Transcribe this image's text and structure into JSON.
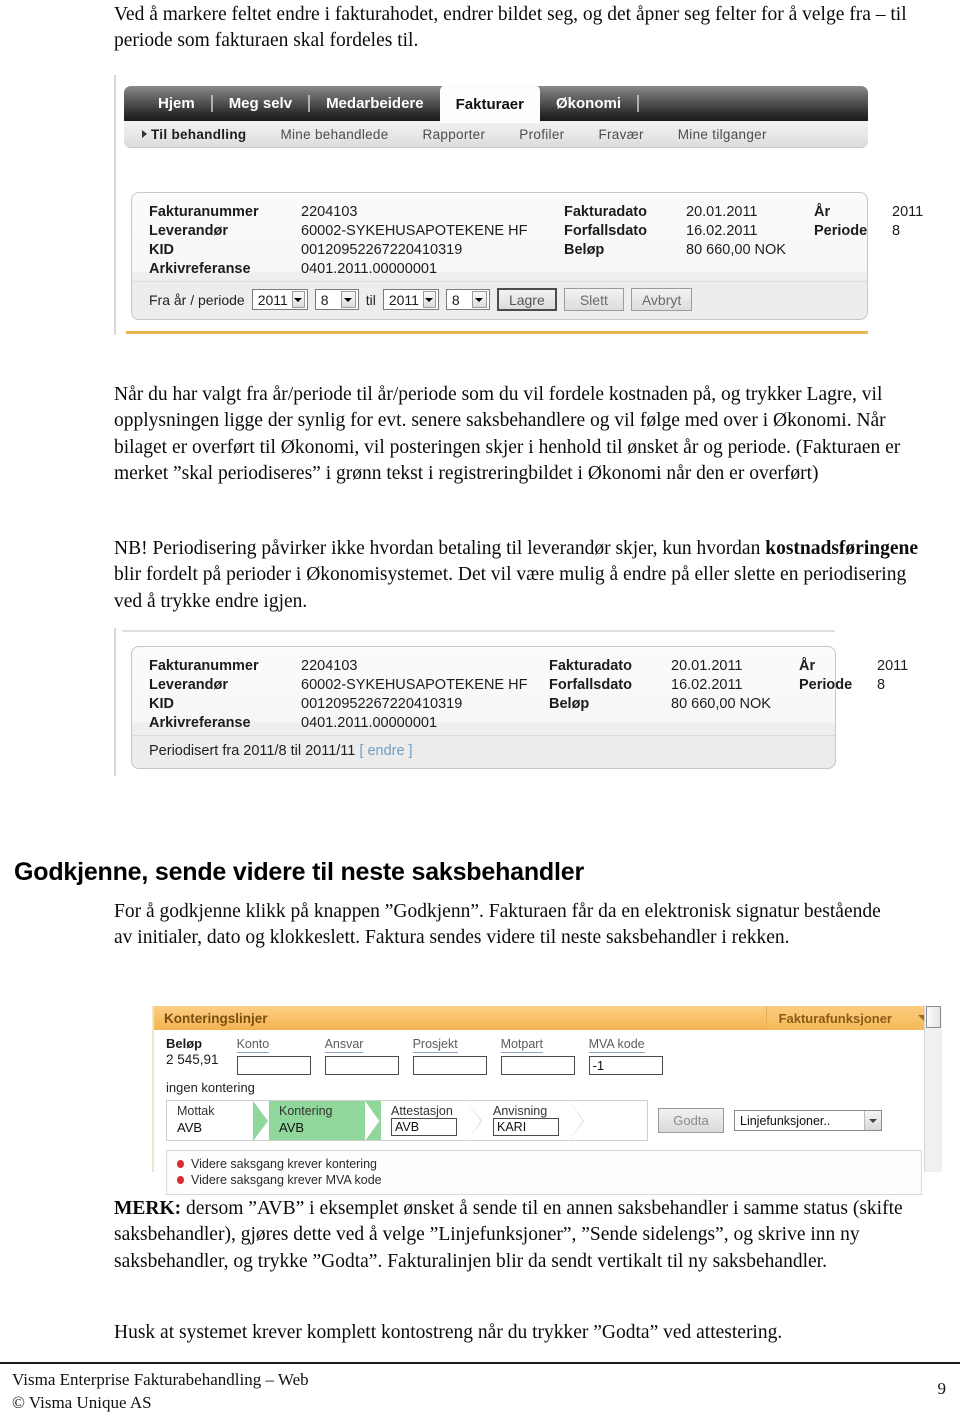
{
  "document": {
    "intro_paragraph": "Ved å markere feltet endre i fakturahodet, endrer bildet seg, og det åpner seg felter for å velge fra – til periode som fakturaen skal fordeles til.",
    "paragraph_2": "Når du har valgt fra år/periode til år/periode som du vil fordele kostnaden på, og trykker Lagre, vil opplysningen ligge der synlig for evt. senere saksbehandlere og vil følge med over i Økonomi. Når bilaget er overført til Økonomi, vil posteringen skjer i henhold til ønsket år og periode. (Fakturaen er merket ”skal periodiseres” i grønn tekst i registreringbildet i Økonomi når den er overført)",
    "paragraph_3_prefix": "NB! Periodisering påvirker ikke hvordan betaling til leverandør skjer, kun hvordan ",
    "paragraph_3_bold": "kostnadsføringene",
    "paragraph_3_suffix": " blir fordelt på perioder i Økonomisystemet. Det vil være mulig å endre på eller slette en periodisering ved å trykke endre igjen.",
    "heading_godkjenne": "Godkjenne, sende videre til neste saksbehandler",
    "paragraph_4": "For å godkjenne klikk på knappen ”Godkjenn”. Fakturaen får da en elektronisk signatur bestående av initialer, dato og klokkeslett. Faktura sendes videre til neste saksbehandler i rekken.",
    "paragraph_5_bold": "MERK:",
    "paragraph_5": " dersom ”AVB” i eksemplet ønsket å sende til en annen saksbehandler i samme status (skifte saksbehandler), gjøres dette ved å velge ”Linjefunksjoner”, ”Sende sidelengs”, og skrive inn ny saksbehandler, og trykke ”Godta”. Fakturalinjen blir da sendt vertikalt til ny saksbehandler.",
    "paragraph_6": "Husk at systemet krever komplett kontostreng når du trykker ”Godta” ved attestering."
  },
  "footer": {
    "line1": "Visma Enterprise Fakturabehandling – Web",
    "line2": "© Visma Unique AS",
    "page_number": "9"
  },
  "screenshot1": {
    "nav_tabs": [
      {
        "label": "Hjem",
        "active": false
      },
      {
        "label": "Meg selv",
        "active": false
      },
      {
        "label": "Medarbeidere",
        "active": false
      },
      {
        "label": "Fakturaer",
        "active": true
      },
      {
        "label": "Økonomi",
        "active": false
      }
    ],
    "sub_nav": [
      {
        "label": "Til behandling",
        "current": true
      },
      {
        "label": "Mine behandlede",
        "current": false
      },
      {
        "label": "Rapporter",
        "current": false
      },
      {
        "label": "Profiler",
        "current": false
      },
      {
        "label": "Fravær",
        "current": false
      },
      {
        "label": "Mine tilganger",
        "current": false
      }
    ],
    "invoice": {
      "fakturanummer_label": "Fakturanummer",
      "fakturanummer_value": "2204103",
      "fakturadato_label": "Fakturadato",
      "fakturadato_value": "20.01.2011",
      "ar_label": "År",
      "ar_value": "2011",
      "leverandor_label": "Leverandør",
      "leverandor_value": "60002-SYKEHUSAPOTEKENE HF",
      "forfallsdato_label": "Forfallsdato",
      "forfallsdato_value": "16.02.2011",
      "periode_label": "Periode",
      "periode_value": "8",
      "kid_label": "KID",
      "kid_value": "00120952267220410319",
      "belop_label": "Beløp",
      "belop_value": "80 660,00 NOK",
      "arkivreferanse_label": "Arkivreferanse",
      "arkivreferanse_value": "0401.2011.00000001"
    },
    "period_editor": {
      "label": "Fra år / periode",
      "from_year": "2011",
      "from_period": "8",
      "til_label": "til",
      "to_year": "2011",
      "to_period": "8",
      "save_button": "Lagre",
      "delete_button": "Slett",
      "cancel_button": "Avbryt"
    }
  },
  "screenshot2": {
    "invoice": {
      "fakturanummer_label": "Fakturanummer",
      "fakturanummer_value": "2204103",
      "fakturadato_label": "Fakturadato",
      "fakturadato_value": "20.01.2011",
      "ar_label": "År",
      "ar_value": "2011",
      "leverandor_label": "Leverandør",
      "leverandor_value": "60002-SYKEHUSAPOTEKENE HF",
      "forfallsdato_label": "Forfallsdato",
      "forfallsdato_value": "16.02.2011",
      "periode_label": "Periode",
      "periode_value": "8",
      "kid_label": "KID",
      "kid_value": "00120952267220410319",
      "belop_label": "Beløp",
      "belop_value": "80 660,00 NOK",
      "arkivreferanse_label": "Arkivreferanse",
      "arkivreferanse_value": "0401.2011.00000001"
    },
    "periodisert_text": "Periodisert fra 2011/8 til 2011/11",
    "endre_link": "[ endre ]"
  },
  "screenshot3": {
    "panel_title": "Konteringslinjer",
    "faktura_funksjoner": "Fakturafunksjoner",
    "belop_label": "Beløp",
    "belop_value": "2 545,91",
    "ingen_kontering": "ingen kontering",
    "fields": [
      {
        "header": "Konto",
        "value": ""
      },
      {
        "header": "Ansvar",
        "value": ""
      },
      {
        "header": "Prosjekt",
        "value": ""
      },
      {
        "header": "Motpart",
        "value": ""
      },
      {
        "header": "MVA kode",
        "value": "-1"
      }
    ],
    "workflow": [
      {
        "label": "Mottak",
        "value": "AVB",
        "type": "text",
        "active": false
      },
      {
        "label": "Kontering",
        "value": "AVB",
        "type": "text",
        "active": true
      },
      {
        "label": "Attestasjon",
        "value": "AVB",
        "type": "input",
        "active": false
      },
      {
        "label": "Anvisning",
        "value": "KARI",
        "type": "input",
        "active": false
      }
    ],
    "godta_button": "Godta",
    "linjefunksjoner_select": "Linjefunksjoner..",
    "errors": [
      "Videre saksgang krever kontering",
      "Videre saksgang krever MVA kode"
    ],
    "accent_orange": "#f4b351",
    "accent_green": "#8fd79a",
    "error_red": "#d92b2b"
  }
}
